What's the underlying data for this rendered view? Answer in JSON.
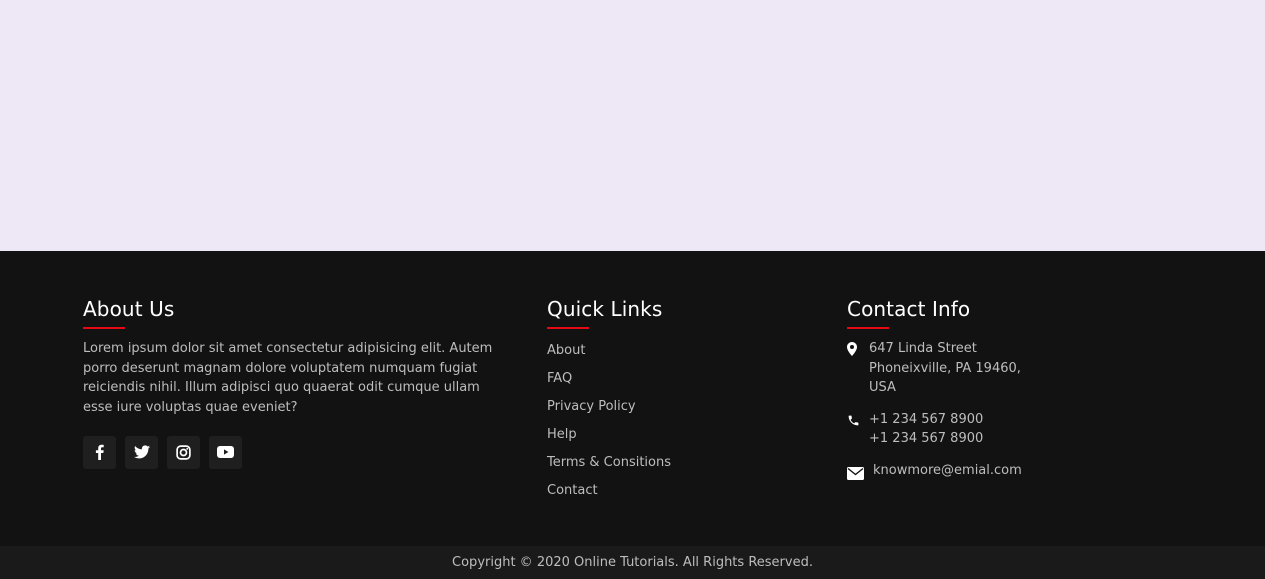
{
  "about": {
    "title": "About Us",
    "text": "Lorem ipsum dolor sit amet consectetur adipisicing elit. Autem porro deserunt magnam dolore voluptatem numquam fugiat reiciendis nihil. Illum adipisci quo quaerat odit cumque ullam esse iure voluptas quae eveniet?",
    "social": [
      {
        "icon": "facebook-icon"
      },
      {
        "icon": "twitter-icon"
      },
      {
        "icon": "instagram-icon"
      },
      {
        "icon": "youtube-icon"
      }
    ]
  },
  "quick_links": {
    "title": "Quick Links",
    "items": [
      "About",
      "FAQ",
      "Privacy Policy",
      "Help",
      "Terms & Consitions",
      "Contact"
    ]
  },
  "contact": {
    "title": "Contact Info",
    "address": [
      "647 Linda Street",
      "Phoneixville, PA 19460,",
      "USA"
    ],
    "phones": [
      "+1 234 567 8900",
      "+1 234 567 8900"
    ],
    "email": "knowmore@emial.com"
  },
  "copyright": "Copyright © 2020 Online Tutorials. All Rights Reserved.",
  "colors": {
    "top_background": "#ede7f6",
    "footer_background": "#121212",
    "accent": "#e50914"
  }
}
